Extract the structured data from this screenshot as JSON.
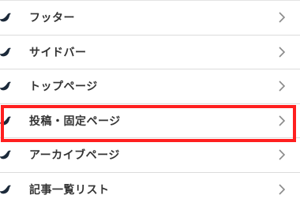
{
  "menu": {
    "items": [
      {
        "label": "フッター",
        "icon": "wing-icon",
        "arrow": "chevron-right-icon"
      },
      {
        "label": "サイドバー",
        "icon": "wing-icon",
        "arrow": "chevron-right-icon"
      },
      {
        "label": "トップページ",
        "icon": "wing-icon",
        "arrow": "chevron-right-icon"
      },
      {
        "label": "投稿・固定ページ",
        "icon": "wing-icon",
        "arrow": "chevron-right-icon",
        "highlighted": true
      },
      {
        "label": "アーカイブページ",
        "icon": "wing-icon",
        "arrow": "chevron-right-icon"
      },
      {
        "label": "記事一覧リスト",
        "icon": "wing-icon",
        "arrow": "chevron-right-icon"
      }
    ]
  },
  "colors": {
    "text": "#333333",
    "divider": "#dcdcdc",
    "icon": "#1c2a3a",
    "chevron": "#8a8a8a",
    "highlight": "#ff1f1f"
  }
}
